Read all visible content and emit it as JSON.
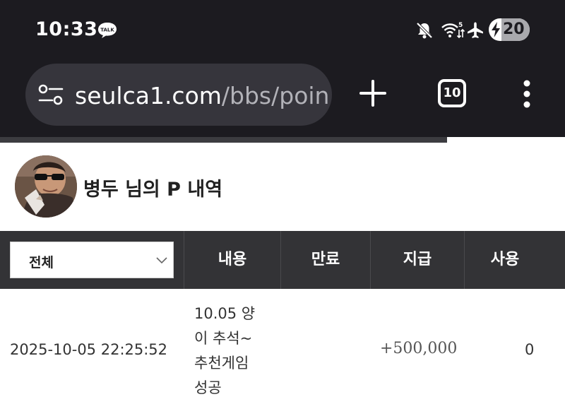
{
  "status_bar": {
    "time": "10:33",
    "talk_badge": "TALK",
    "wifi_label": "5",
    "battery_level": "20",
    "icons": [
      "talk-icon",
      "mute-icon",
      "wifi-icon",
      "airplane-icon",
      "battery-icon"
    ]
  },
  "browser": {
    "url_domain": "seulca1.com",
    "url_path": "/bbs/poin",
    "tab_count": "10",
    "icons": [
      "site-settings-icon",
      "plus-icon",
      "tabs-icon",
      "more-vert-icon"
    ]
  },
  "profile": {
    "title": "병두 님의 P 내역"
  },
  "table": {
    "filter_value": "전체",
    "headers": [
      "내용",
      "만료",
      "지급",
      "사용"
    ],
    "rows": [
      {
        "date": "2025-10-05 22:25:52",
        "content_lines": [
          "10.05 양",
          "이 추석~",
          "추천게임",
          "성공"
        ],
        "expire": "",
        "earned": "+500,000",
        "used": "0"
      }
    ]
  },
  "colors": {
    "chrome_bg": "#1c1b20",
    "url_pill": "#36353c",
    "table_header": "#333336"
  }
}
